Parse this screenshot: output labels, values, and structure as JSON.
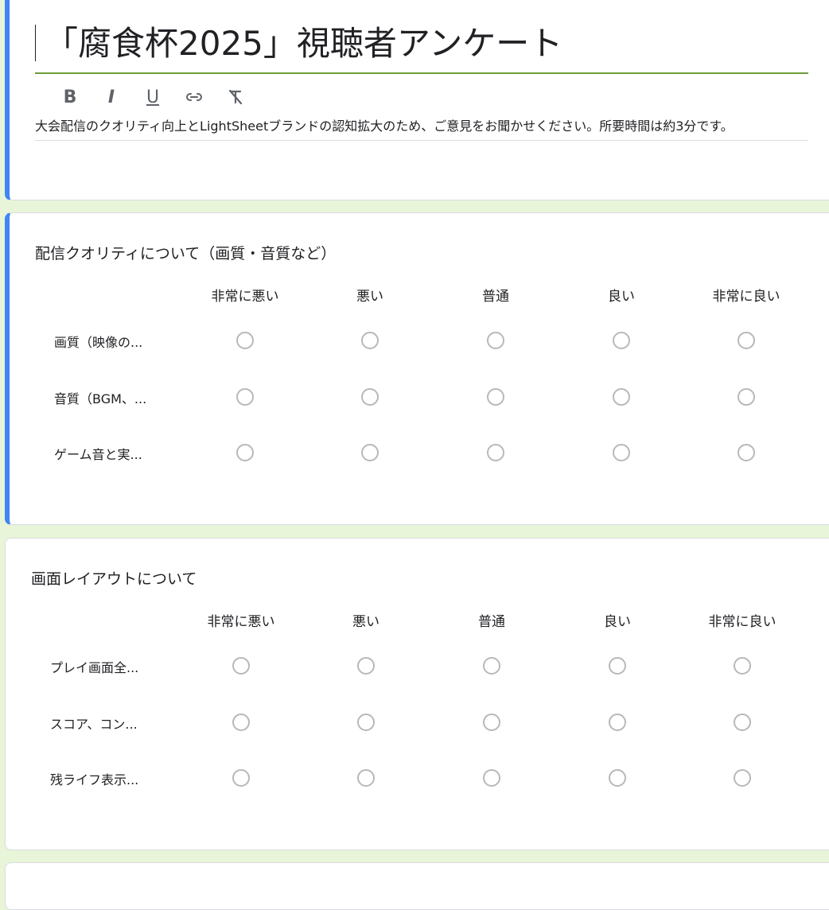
{
  "form": {
    "title": "「腐食杯2025」視聴者アンケート",
    "description": "大会配信のクオリティ向上とLightSheetブランドの認知拡大のため、ご意見をお聞かせください。所要時間は約3分です。",
    "toolbar": [
      "B",
      "I",
      "U",
      "link",
      "clear-format"
    ]
  },
  "scale": [
    "非常に悪い",
    "悪い",
    "普通",
    "良い",
    "非常に良い"
  ],
  "questions": [
    {
      "title": "配信クオリティについて（画質・音質など）",
      "rows": [
        "画質（映像の...",
        "音質（BGM、...",
        "ゲーム音と実..."
      ]
    },
    {
      "title": "画面レイアウトについて",
      "rows": [
        "プレイ画面全...",
        "スコア、コン...",
        "残ライフ表示..."
      ]
    }
  ],
  "colors": {
    "accent": "#4285f4",
    "title_underline": "#6e9e3a",
    "background": "#e8f5d8"
  }
}
